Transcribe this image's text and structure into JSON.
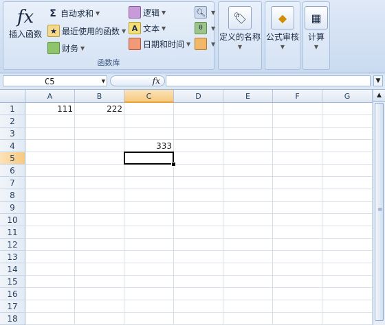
{
  "ribbon": {
    "fx_glyph": "fx",
    "insert_function_label": "插入函数",
    "autosum_label": "自动求和",
    "recent_label": "最近使用的函数",
    "financial_label": "财务",
    "logical_label": "逻辑",
    "text_label": "文本",
    "datetime_label": "日期和时间",
    "group_label": "函数库",
    "defined_names_label": "定义的名称",
    "audit_label": "公式审核",
    "calc_label": "计算"
  },
  "formula_bar": {
    "name_box": "C5",
    "fx_label": "fx",
    "formula": ""
  },
  "columns": [
    "A",
    "B",
    "C",
    "D",
    "E",
    "F",
    "G"
  ],
  "selected_column": "C",
  "rows": [
    "1",
    "2",
    "3",
    "4",
    "5",
    "6",
    "7",
    "8",
    "9",
    "10",
    "11",
    "12",
    "13",
    "14",
    "15",
    "16",
    "17",
    "18"
  ],
  "selected_row": "5",
  "cells": {
    "A1": "111",
    "B1": "222",
    "C4": "333"
  },
  "colors": {
    "accent": "#f7c980",
    "ribbon": "#dfe9f7"
  }
}
